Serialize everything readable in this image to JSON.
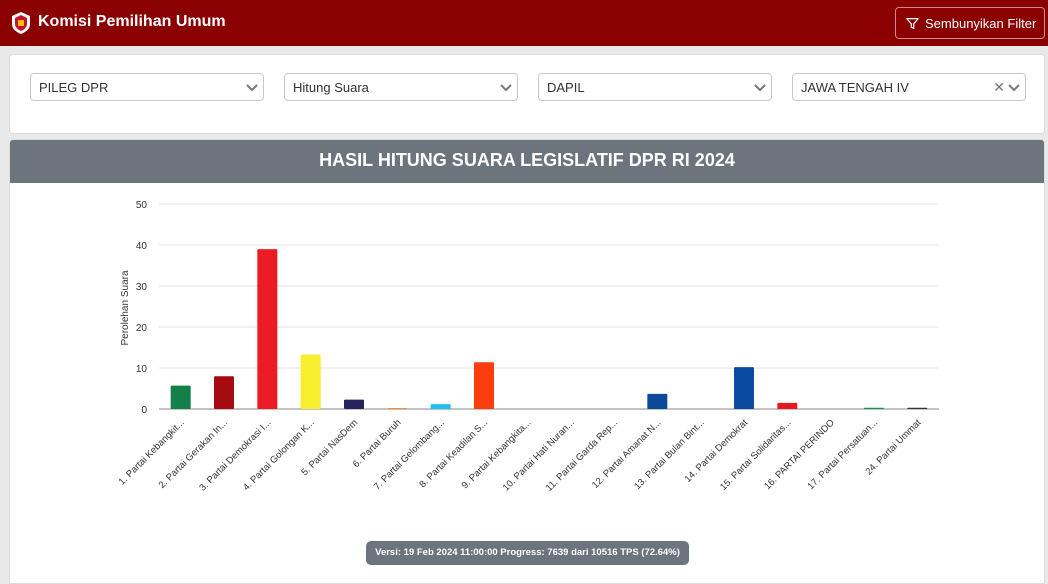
{
  "app": {
    "title": "Komisi Pemilihan Umum",
    "filter_button": "Sembunyikan Filter",
    "accent": "#8b0000"
  },
  "filters": [
    {
      "value": "PILEG DPR",
      "clearable": false
    },
    {
      "value": "Hitung Suara",
      "clearable": false
    },
    {
      "value": "DAPIL",
      "clearable": false
    },
    {
      "value": "JAWA TENGAH IV",
      "clearable": true
    }
  ],
  "chart_title": "HASIL HITUNG SUARA LEGISLATIF DPR RI 2024",
  "chart_data": {
    "type": "bar",
    "title": "HASIL HITUNG SUARA LEGISLATIF DPR RI 2024",
    "ylabel": "Perolehan Suara",
    "xlabel": "",
    "ylim": [
      0,
      50
    ],
    "yticks": [
      0,
      10,
      20,
      30,
      40,
      50
    ],
    "grid": true,
    "categories": [
      "1. Partai Kebangkit...",
      "2. Partai Gerakan In...",
      "3. Partai Demokrasi I...",
      "4. Partai Golongan K...",
      "5. Partai NasDem",
      "6. Partai Buruh",
      "7. Partai Gelombang...",
      "8. Partai Keadilan S...",
      "9. Partai Kebangkita...",
      "10. Partai Hati Nuran...",
      "11. Partai Garda Rep...",
      "12. Partai Amanat N...",
      "13. Partai Bulan Bint...",
      "14. Partai Demokrat",
      "15. Partai Solidaritas...",
      "16. PARTAI PERINDO",
      "17. Partai Persatuan...",
      "24. Partai Ummat"
    ],
    "values": [
      5.7,
      8.0,
      39.0,
      13.3,
      2.3,
      0.2,
      1.2,
      11.4,
      0,
      0,
      0,
      3.7,
      0,
      10.2,
      1.5,
      0,
      0.3,
      0.3
    ],
    "colors": [
      "#128048",
      "#a50c12",
      "#ed1c24",
      "#f7ee2e",
      "#26235e",
      "#f47b20",
      "#1fc2ee",
      "#fe3d0f",
      "#00722d",
      "#f4a21c",
      "#c0392b",
      "#0b4a96",
      "#1a7a33",
      "#0a4aa0",
      "#e61921",
      "#0a2f7a",
      "#17914a",
      "#333333"
    ]
  },
  "footer": {
    "version_text": "Versi: 19 Feb 2024 11:00:00 Progress: 7639 dari 10516 TPS (72.64%)"
  }
}
